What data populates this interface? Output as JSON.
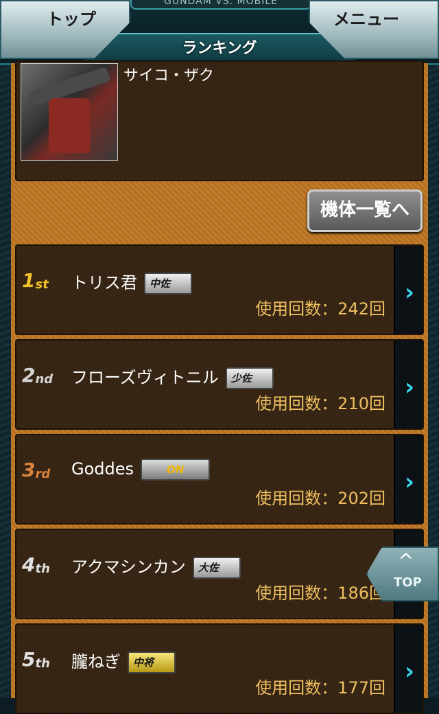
{
  "header": {
    "game_title": "GUNDAM VS. MOBILE",
    "page_title": "ランキング",
    "top_button": "トップ",
    "menu_button": "メニュー"
  },
  "unit": {
    "name": "サイコ・ザク",
    "list_button": "機体一覧へ"
  },
  "rankings": [
    {
      "pos": "1",
      "suffix": "st",
      "name": "トリス君",
      "badge": "中佐",
      "usage": "使用回数：242回"
    },
    {
      "pos": "2",
      "suffix": "nd",
      "name": "フローズヴィトニル",
      "badge": "少佐",
      "usage": "使用回数：210回"
    },
    {
      "pos": "3",
      "suffix": "rd",
      "name": "Goddes",
      "badge": "ON",
      "usage": "使用回数：202回"
    },
    {
      "pos": "4",
      "suffix": "th",
      "name": "アクマシンカン",
      "badge": "大佐",
      "usage": "使用回数：186回"
    },
    {
      "pos": "5",
      "suffix": "th",
      "name": "朧ねぎ",
      "badge": "中将",
      "usage": "使用回数：177回"
    }
  ],
  "top_button": "TOP",
  "icons": {
    "chevron": "chevron-right-icon",
    "up": "chevron-up-icon"
  }
}
